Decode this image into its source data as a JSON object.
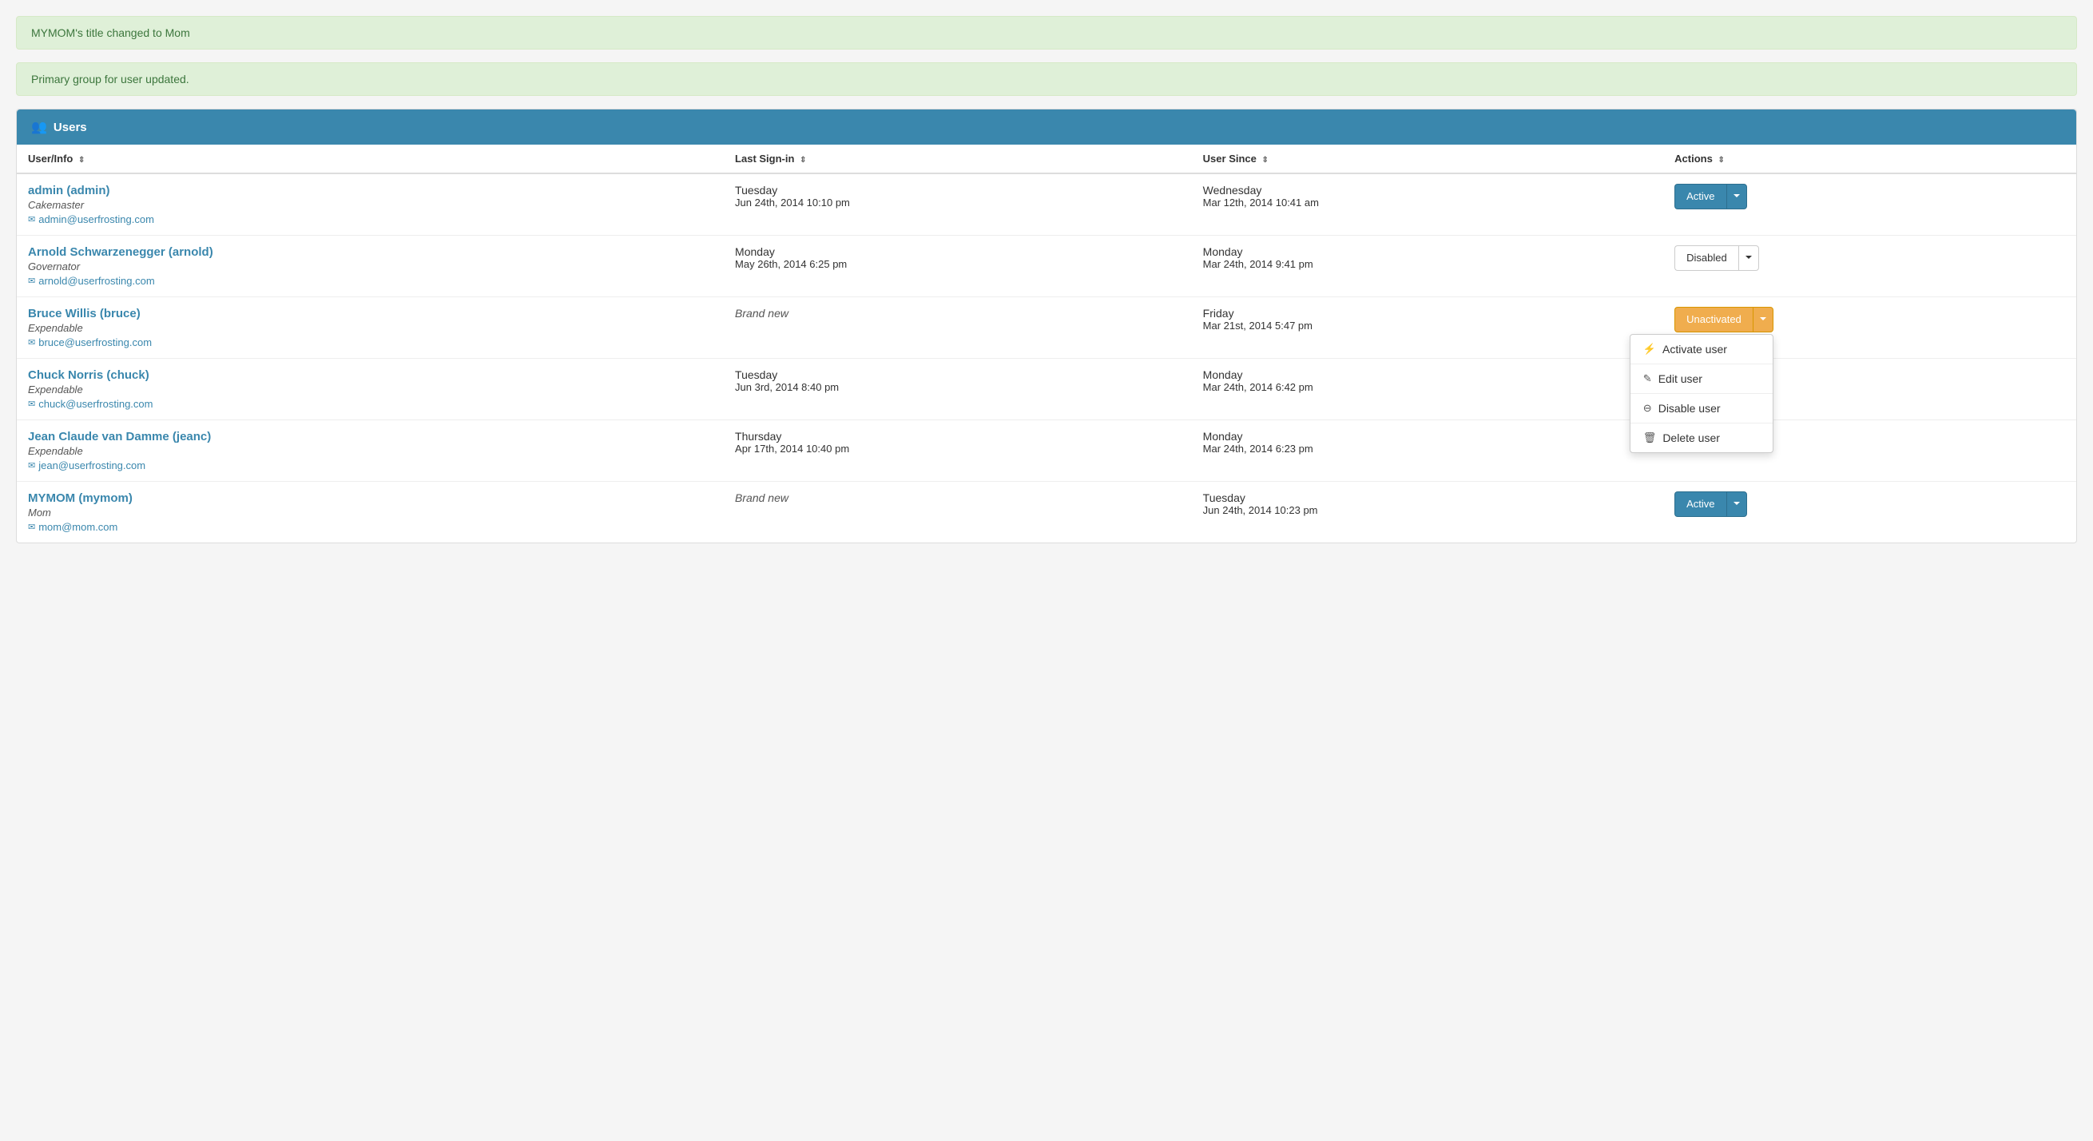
{
  "alerts": [
    {
      "id": "alert-1",
      "message": "MYMOM's title changed to Mom"
    },
    {
      "id": "alert-2",
      "message": "Primary group for user updated."
    }
  ],
  "panel": {
    "title": "Users",
    "icon": "👥"
  },
  "table": {
    "columns": [
      {
        "id": "user-info",
        "label": "User/Info",
        "sortable": true
      },
      {
        "id": "last-signin",
        "label": "Last Sign-in",
        "sortable": true
      },
      {
        "id": "user-since",
        "label": "User Since",
        "sortable": true
      },
      {
        "id": "actions",
        "label": "Actions",
        "sortable": true
      }
    ],
    "rows": [
      {
        "id": "row-admin",
        "name": "admin (admin)",
        "title": "Cakemaster",
        "email": "admin@userfrosting.com",
        "lastSigninDay": "Tuesday",
        "lastSigninDate": "Jun 24th, 2014 10:10 pm",
        "userSinceDay": "Wednesday",
        "userSinceDate": "Mar 12th, 2014 10:41 am",
        "status": "Active",
        "statusType": "primary",
        "brandNew": false
      },
      {
        "id": "row-arnold",
        "name": "Arnold Schwarzenegger (arnold)",
        "title": "Governator",
        "email": "arnold@userfrosting.com",
        "lastSigninDay": "Monday",
        "lastSigninDate": "May 26th, 2014 6:25 pm",
        "userSinceDay": "Monday",
        "userSinceDate": "Mar 24th, 2014 9:41 pm",
        "status": "Disabled",
        "statusType": "default",
        "brandNew": false
      },
      {
        "id": "row-bruce",
        "name": "Bruce Willis (bruce)",
        "title": "Expendable",
        "email": "bruce@userfrosting.com",
        "lastSigninDay": "",
        "lastSigninDate": "Brand new",
        "userSinceDay": "Friday",
        "userSinceDate": "Mar 21st, 2014 5:47 pm",
        "status": "Unactivated",
        "statusType": "warning",
        "brandNew": true,
        "dropdownOpen": true
      },
      {
        "id": "row-chuck",
        "name": "Chuck Norris (chuck)",
        "title": "Expendable",
        "email": "chuck@userfrosting.com",
        "lastSigninDay": "Tuesday",
        "lastSigninDate": "Jun 3rd, 2014 8:40 pm",
        "userSinceDay": "Monday",
        "userSinceDate": "Mar 24th, 2014 6:42 pm",
        "status": "",
        "statusType": "none",
        "brandNew": false
      },
      {
        "id": "row-jean",
        "name": "Jean Claude van Damme (jeanc)",
        "title": "Expendable",
        "email": "jean@userfrosting.com",
        "lastSigninDay": "Thursday",
        "lastSigninDate": "Apr 17th, 2014 10:40 pm",
        "userSinceDay": "Monday",
        "userSinceDate": "Mar 24th, 2014 6:23 pm",
        "status": "",
        "statusType": "none",
        "brandNew": false
      },
      {
        "id": "row-mymom",
        "name": "MYMOM (mymom)",
        "title": "Mom",
        "email": "mom@mom.com",
        "lastSigninDay": "",
        "lastSigninDate": "Brand new",
        "userSinceDay": "Tuesday",
        "userSinceDate": "Jun 24th, 2014 10:23 pm",
        "status": "Active",
        "statusType": "primary",
        "brandNew": true
      }
    ],
    "dropdown": {
      "items": [
        {
          "id": "activate-user",
          "label": "Activate user",
          "icon": "⚡"
        },
        {
          "id": "edit-user",
          "label": "Edit user",
          "icon": "✎"
        },
        {
          "id": "disable-user",
          "label": "Disable user",
          "icon": "⊖"
        },
        {
          "id": "delete-user",
          "label": "Delete user",
          "icon": "🗑"
        }
      ]
    }
  }
}
